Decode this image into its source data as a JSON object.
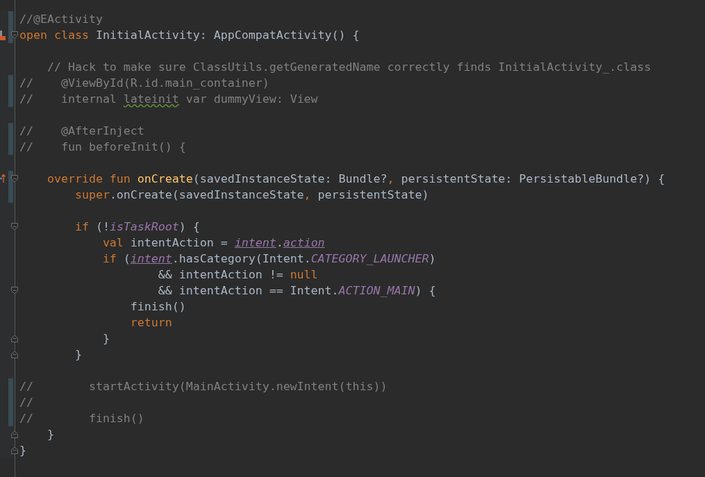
{
  "editor": {
    "lines": [
      {
        "changed": true,
        "fold_start": false,
        "fold_end": false,
        "implemented": false,
        "overrides": false,
        "tokens": [
          {
            "kind": "comment",
            "text": "//@EActivity"
          }
        ]
      },
      {
        "changed": true,
        "fold_start": true,
        "fold_end": false,
        "implemented": true,
        "overrides": false,
        "tokens": [
          {
            "kind": "keyword",
            "text": "open class "
          },
          {
            "kind": "plain",
            "text": "InitialActivity: AppCompatActivity() {"
          }
        ]
      },
      {
        "changed": false,
        "fold_start": false,
        "fold_end": false,
        "implemented": false,
        "overrides": false
      },
      {
        "changed": false,
        "fold_start": false,
        "fold_end": false,
        "implemented": false,
        "overrides": false,
        "tokens": [
          {
            "kind": "comment",
            "text": "    // Hack to make sure ClassUtils.getGeneratedName correctly finds InitialActivity_.class"
          }
        ]
      },
      {
        "changed": true,
        "fold_start": false,
        "fold_end": false,
        "implemented": false,
        "overrides": false,
        "tokens": [
          {
            "kind": "comment",
            "text": "//    @ViewById(R.id.main_container)"
          }
        ]
      },
      {
        "changed": true,
        "fold_start": false,
        "fold_end": false,
        "implemented": false,
        "overrides": false,
        "tokens": [
          {
            "kind": "comment",
            "text": "//    internal "
          },
          {
            "kind": "typo",
            "text": "lateinit"
          },
          {
            "kind": "comment",
            "text": " var dummyView: View"
          }
        ]
      },
      {
        "changed": false,
        "fold_start": false,
        "fold_end": false,
        "implemented": false,
        "overrides": false
      },
      {
        "changed": true,
        "fold_start": false,
        "fold_end": false,
        "implemented": false,
        "overrides": false,
        "tokens": [
          {
            "kind": "comment",
            "text": "//    @AfterInject"
          }
        ]
      },
      {
        "changed": true,
        "fold_start": false,
        "fold_end": false,
        "implemented": false,
        "overrides": false,
        "tokens": [
          {
            "kind": "comment",
            "text": "//    fun beforeInit() {"
          }
        ]
      },
      {
        "changed": false,
        "fold_start": false,
        "fold_end": false,
        "implemented": false,
        "overrides": false
      },
      {
        "changed": true,
        "fold_start": true,
        "fold_end": false,
        "implemented": false,
        "overrides": true,
        "tokens": [
          {
            "kind": "keyword",
            "text": "    override fun "
          },
          {
            "kind": "function",
            "text": "onCreate"
          },
          {
            "kind": "plain",
            "text": "(savedInstanceState: Bundle?"
          },
          {
            "kind": "keyword",
            "text": ","
          },
          {
            "kind": "plain",
            "text": " persistentState: PersistableBundle?) {"
          }
        ]
      },
      {
        "changed": true,
        "fold_start": false,
        "fold_end": false,
        "implemented": false,
        "overrides": false,
        "tokens": [
          {
            "kind": "keyword",
            "text": "        super"
          },
          {
            "kind": "plain",
            "text": ".onCreate(savedInstanceState"
          },
          {
            "kind": "keyword",
            "text": ","
          },
          {
            "kind": "plain",
            "text": " persistentState)"
          }
        ]
      },
      {
        "changed": false,
        "fold_start": false,
        "fold_end": false,
        "implemented": false,
        "overrides": false
      },
      {
        "changed": false,
        "fold_start": true,
        "fold_end": false,
        "implemented": false,
        "overrides": false,
        "tokens": [
          {
            "kind": "keyword",
            "text": "        if "
          },
          {
            "kind": "plain",
            "text": "(!"
          },
          {
            "kind": "static",
            "text": "isTaskRoot"
          },
          {
            "kind": "plain",
            "text": ") {"
          }
        ]
      },
      {
        "changed": false,
        "fold_start": false,
        "fold_end": false,
        "implemented": false,
        "overrides": false,
        "tokens": [
          {
            "kind": "keyword",
            "text": "            val "
          },
          {
            "kind": "plain",
            "text": "intentAction = "
          },
          {
            "kind": "property",
            "text": "intent"
          },
          {
            "kind": "plain",
            "text": "."
          },
          {
            "kind": "property",
            "text": "action"
          }
        ]
      },
      {
        "changed": false,
        "fold_start": false,
        "fold_end": false,
        "implemented": false,
        "overrides": false,
        "tokens": [
          {
            "kind": "keyword",
            "text": "            if "
          },
          {
            "kind": "plain",
            "text": "("
          },
          {
            "kind": "property",
            "text": "intent"
          },
          {
            "kind": "plain",
            "text": ".hasCategory(Intent."
          },
          {
            "kind": "static",
            "text": "CATEGORY_LAUNCHER"
          },
          {
            "kind": "plain",
            "text": ")"
          }
        ]
      },
      {
        "changed": false,
        "fold_start": false,
        "fold_end": false,
        "implemented": false,
        "overrides": false,
        "tokens": [
          {
            "kind": "plain",
            "text": "                    && intentAction != "
          },
          {
            "kind": "keyword",
            "text": "null"
          }
        ]
      },
      {
        "changed": false,
        "fold_start": true,
        "fold_end": false,
        "implemented": false,
        "overrides": false,
        "tokens": [
          {
            "kind": "plain",
            "text": "                    && intentAction == Intent."
          },
          {
            "kind": "static",
            "text": "ACTION_MAIN"
          },
          {
            "kind": "plain",
            "text": ") {"
          }
        ]
      },
      {
        "changed": false,
        "fold_start": false,
        "fold_end": false,
        "implemented": false,
        "overrides": false,
        "tokens": [
          {
            "kind": "plain",
            "text": "                finish()"
          }
        ]
      },
      {
        "changed": false,
        "fold_start": false,
        "fold_end": false,
        "implemented": false,
        "overrides": false,
        "tokens": [
          {
            "kind": "keyword",
            "text": "                return"
          }
        ]
      },
      {
        "changed": false,
        "fold_start": false,
        "fold_end": true,
        "implemented": false,
        "overrides": false,
        "tokens": [
          {
            "kind": "plain",
            "text": "            }"
          }
        ]
      },
      {
        "changed": false,
        "fold_start": false,
        "fold_end": true,
        "implemented": false,
        "overrides": false,
        "tokens": [
          {
            "kind": "plain",
            "text": "        }"
          }
        ]
      },
      {
        "changed": false,
        "fold_start": false,
        "fold_end": false,
        "implemented": false,
        "overrides": false
      },
      {
        "changed": true,
        "fold_start": false,
        "fold_end": false,
        "implemented": false,
        "overrides": false,
        "tokens": [
          {
            "kind": "comment",
            "text": "//        startActivity(MainActivity.newIntent(this))"
          }
        ]
      },
      {
        "changed": true,
        "fold_start": false,
        "fold_end": false,
        "implemented": false,
        "overrides": false,
        "tokens": [
          {
            "kind": "comment",
            "text": "//"
          }
        ]
      },
      {
        "changed": true,
        "fold_start": false,
        "fold_end": false,
        "implemented": false,
        "overrides": false,
        "tokens": [
          {
            "kind": "comment",
            "text": "//        finish()"
          }
        ]
      },
      {
        "changed": false,
        "fold_start": false,
        "fold_end": true,
        "implemented": false,
        "overrides": false,
        "tokens": [
          {
            "kind": "plain",
            "text": "    }"
          }
        ]
      },
      {
        "changed": false,
        "fold_start": false,
        "fold_end": true,
        "implemented": false,
        "overrides": false,
        "tokens": [
          {
            "kind": "plain",
            "text": "}"
          }
        ]
      }
    ]
  }
}
